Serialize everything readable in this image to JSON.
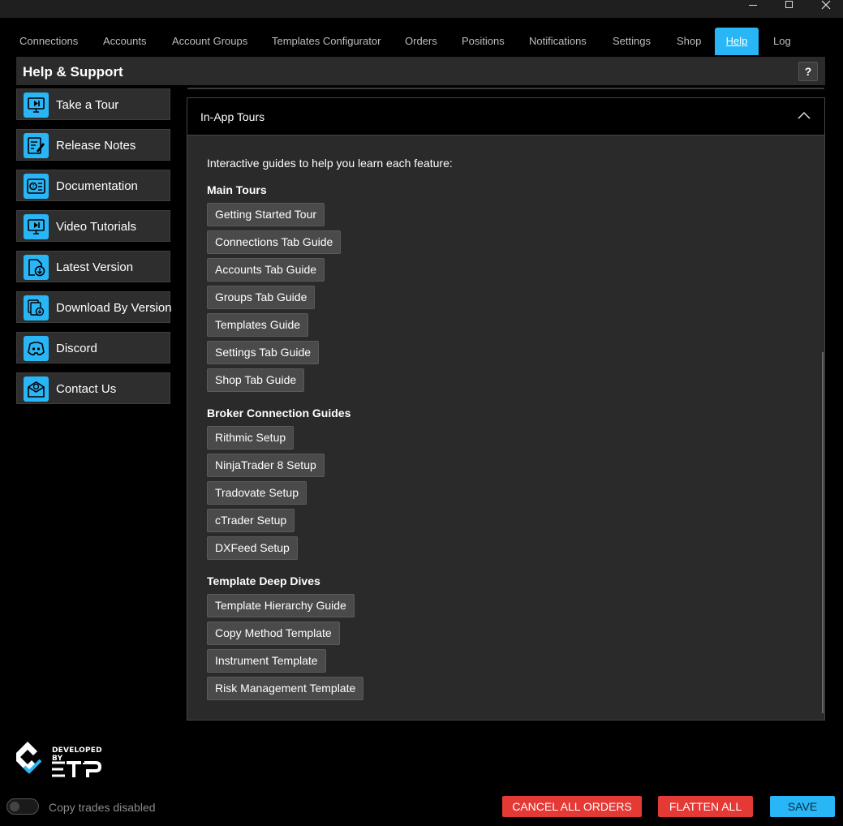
{
  "window": {
    "controls": [
      "minimize-icon",
      "maximize-icon",
      "close-icon"
    ]
  },
  "tabs": [
    {
      "label": "Connections",
      "active": false
    },
    {
      "label": "Accounts",
      "active": false
    },
    {
      "label": "Account Groups",
      "active": false
    },
    {
      "label": "Templates Configurator",
      "active": false
    },
    {
      "label": "Orders",
      "active": false
    },
    {
      "label": "Positions",
      "active": false
    },
    {
      "label": "Notifications",
      "active": false
    },
    {
      "label": "Settings",
      "active": false
    },
    {
      "label": "Shop",
      "active": false
    },
    {
      "label": "Help",
      "active": true
    },
    {
      "label": "Log",
      "active": false
    }
  ],
  "header": {
    "title": "Help & Support",
    "help_button": "?"
  },
  "sidebar": {
    "items": [
      {
        "label": "Take a Tour",
        "icon": "tour-icon"
      },
      {
        "label": "Release Notes",
        "icon": "release-notes-icon"
      },
      {
        "label": "Documentation",
        "icon": "documentation-icon"
      },
      {
        "label": "Video Tutorials",
        "icon": "video-icon"
      },
      {
        "label": "Latest Version",
        "icon": "download-icon"
      },
      {
        "label": "Download By Version",
        "icon": "versions-icon"
      },
      {
        "label": "Discord",
        "icon": "discord-icon"
      },
      {
        "label": "Contact Us",
        "icon": "mail-icon"
      }
    ]
  },
  "panel": {
    "title": "In-App Tours",
    "expanded": true,
    "intro": "Interactive guides to help you learn each feature:",
    "sections": [
      {
        "title": "Main Tours",
        "buttons": [
          "Getting Started Tour",
          "Connections Tab Guide",
          "Accounts Tab Guide",
          "Groups Tab Guide",
          "Templates Guide",
          "Settings Tab Guide",
          "Shop Tab Guide"
        ]
      },
      {
        "title": "Broker Connection Guides",
        "buttons": [
          "Rithmic Setup",
          "NinjaTrader 8 Setup",
          "Tradovate Setup",
          "cTrader Setup",
          "DXFeed Setup"
        ]
      },
      {
        "title": "Template Deep Dives",
        "buttons": [
          "Template Hierarchy Guide",
          "Copy Method Template",
          "Instrument Template",
          "Risk Management Template"
        ]
      }
    ]
  },
  "logo": {
    "developed_by": "DEVELOPED BY"
  },
  "footer": {
    "copy_toggle_label": "Copy trades disabled",
    "copy_enabled": false,
    "cancel_all_orders": "CANCEL ALL ORDERS",
    "flatten_all": "FLATTEN ALL",
    "save": "SAVE"
  },
  "colors": {
    "accent": "#29b6f6",
    "danger": "#e53935",
    "background": "#000000",
    "panel": "#2a2a2a"
  }
}
